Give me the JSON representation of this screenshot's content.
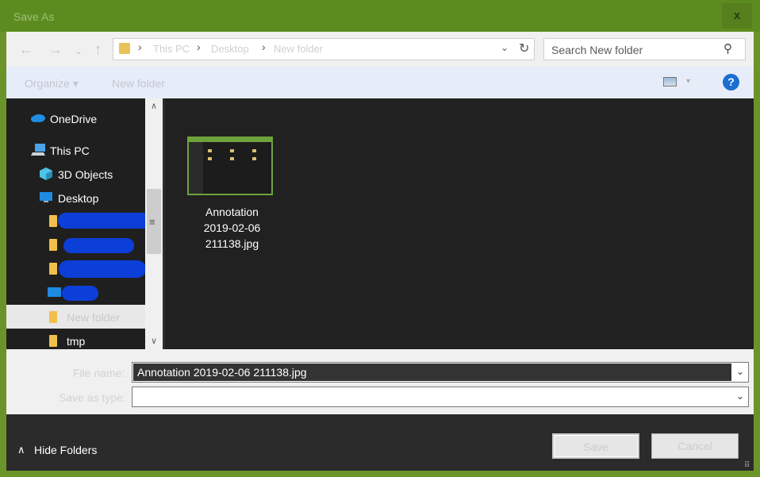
{
  "window": {
    "title": "Save As",
    "close_glyph": "x"
  },
  "nav": {
    "back": "←",
    "forward": "→",
    "recent": "⌄",
    "up": "↑"
  },
  "breadcrumb": [
    "This PC",
    "Desktop",
    "New folder"
  ],
  "breadcrumb_sep": "›",
  "address": {
    "dropdown": "⌄",
    "refresh": "↻"
  },
  "search": {
    "placeholder": "Search New folder",
    "icon": "⚲"
  },
  "toolbar": {
    "organize": "Organize ▾",
    "new_folder": "New folder",
    "view_dd": "▾",
    "help": "?"
  },
  "sidebar": {
    "onedrive": "OneDrive",
    "this_pc": "This PC",
    "objects3d": "3D Objects",
    "desktop": "Desktop",
    "new_folder": "New folder",
    "tmp": "tmp"
  },
  "scrollbar": {
    "up": "∧",
    "down": "∨",
    "grip": "≡"
  },
  "file": {
    "line1": "Annotation",
    "line2": "2019-02-06",
    "line3": "211138.jpg"
  },
  "form": {
    "file_name_label": "File name:",
    "file_name_value": "Annotation 2019-02-06 211138.jpg",
    "save_as_type_label": "Save as type:",
    "save_as_type_value": "",
    "dd_arrow": "⌄"
  },
  "footer": {
    "hide_arrow": "∧",
    "hide_folders": "Hide Folders",
    "save": "Save",
    "cancel": "Cancel",
    "grip": "⠿"
  },
  "colors": {
    "title_bar": "#5c8c1f",
    "accent": "#1a6fd0",
    "redaction": "#0c3fd8"
  }
}
